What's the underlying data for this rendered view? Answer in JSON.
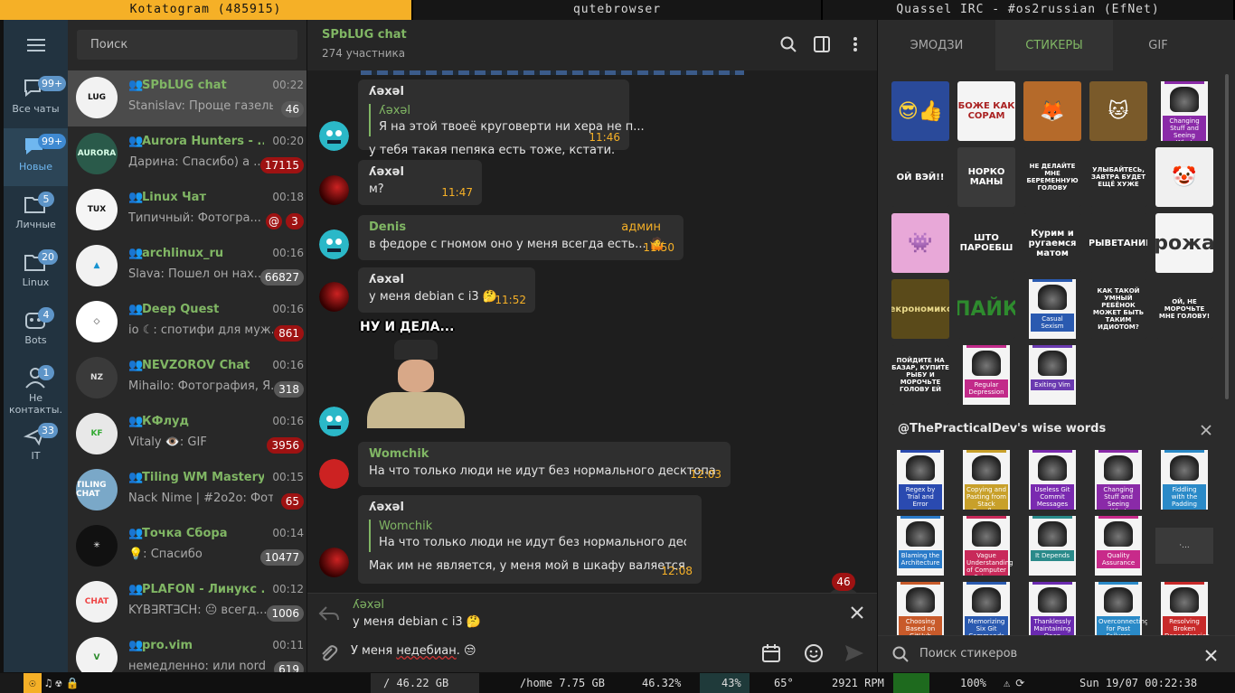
{
  "topbar": {
    "tabs": [
      {
        "label": "Kotatogram (485915)",
        "active": true
      },
      {
        "label": "qutebrowser",
        "active": false
      },
      {
        "label": "Quassel IRC - #os2russian (EfNet)",
        "active": false
      }
    ]
  },
  "folders": [
    {
      "label": "Все чаты",
      "badge": "99+",
      "icon": "chat-bubbles-icon",
      "active": false
    },
    {
      "label": "Новые",
      "badge": "99+",
      "icon": "chat-bubble-icon",
      "active": true
    },
    {
      "label": "Личные",
      "badge": "5",
      "icon": "folder-icon",
      "active": false
    },
    {
      "label": "Linux",
      "badge": "20",
      "icon": "folder-icon",
      "active": false
    },
    {
      "label": "Bots",
      "badge": "4",
      "icon": "bot-icon",
      "active": false
    },
    {
      "label": "Не контакты.",
      "badge": "1",
      "icon": "person-icon",
      "active": false
    },
    {
      "label": "IT",
      "badge": "33",
      "icon": "plane-icon",
      "active": false
    }
  ],
  "chatlist": {
    "search_placeholder": "Поиск",
    "chats": [
      {
        "name": "SPbLUG chat",
        "time": "00:22",
        "preview": "Stanislav: Проще газель ...",
        "badge": "46",
        "red": false,
        "mention": false,
        "selected": true,
        "av_bg": "#f2f2f2",
        "av_fg": "#111",
        "av_text": "LUG"
      },
      {
        "name": "Aurora Hunters - ...",
        "time": "00:20",
        "preview": "Дарина: Спасибо) а ...",
        "badge": "17115",
        "red": true,
        "mention": false,
        "selected": false,
        "av_bg": "#2a5a4a",
        "av_fg": "#d8ffe8",
        "av_text": "AURORA"
      },
      {
        "name": "Linux Чат",
        "time": "00:18",
        "preview": "Типичный: Фотогра...",
        "badge": "3",
        "red": true,
        "mention": true,
        "selected": false,
        "av_bg": "#f5f5f5",
        "av_fg": "#111",
        "av_text": "TUX"
      },
      {
        "name": "archlinux_ru",
        "time": "00:16",
        "preview": "Slava: Пошел он нах...",
        "badge": "66827",
        "red": false,
        "mention": false,
        "selected": false,
        "av_bg": "#f2f2f2",
        "av_fg": "#1793d1",
        "av_text": "▲"
      },
      {
        "name": "Deep Quest",
        "time": "00:16",
        "preview": "io ☾: спотифи для муж...",
        "badge": "861",
        "red": true,
        "mention": false,
        "selected": false,
        "av_bg": "#ffffff",
        "av_fg": "#333",
        "av_text": "◇"
      },
      {
        "name": "NEVZOROV Chat",
        "time": "00:16",
        "preview": "Mihailo: Фотография, Я...",
        "badge": "318",
        "red": false,
        "mention": false,
        "selected": false,
        "av_bg": "#3a3a3a",
        "av_fg": "#ddd",
        "av_text": "NZ"
      },
      {
        "name": "КФлуд",
        "time": "00:16",
        "preview": "Vitaly 👁️: GIF",
        "badge": "3956",
        "red": true,
        "mention": false,
        "selected": false,
        "av_bg": "#e8e8e8",
        "av_fg": "#3a3",
        "av_text": "KF"
      },
      {
        "name": "Tiling WM Mastery",
        "time": "00:15",
        "preview": "Nack Nime | #2o2o: Фот...",
        "badge": "65",
        "red": true,
        "mention": false,
        "selected": false,
        "av_bg": "#7aa8c8",
        "av_fg": "#fff",
        "av_text": "TILING CHAT"
      },
      {
        "name": "Точка Сбора",
        "time": "00:14",
        "preview": "💡: Спасибо",
        "badge": "10477",
        "red": false,
        "mention": false,
        "selected": false,
        "av_bg": "#111",
        "av_fg": "#fff",
        "av_text": "✳"
      },
      {
        "name": "PLAFON - Линукс ...",
        "time": "00:12",
        "preview": "KYB∃RT∃CH: 😐 всегд...",
        "badge": "1006",
        "red": false,
        "mention": false,
        "selected": false,
        "av_bg": "#f2f2f2",
        "av_fg": "#e44",
        "av_text": "CHAT"
      },
      {
        "name": "pro.vim",
        "time": "00:11",
        "preview": "немедленно: или nord",
        "badge": "619",
        "red": false,
        "mention": false,
        "selected": false,
        "av_bg": "#f2f2f2",
        "av_fg": "#2a8a2a",
        "av_text": "V"
      }
    ]
  },
  "chat": {
    "title": "SPbLUG chat",
    "subtitle": "274 участника",
    "messages": [
      {
        "sender": "ʎəxəl",
        "reply_name": "ʎəxəl",
        "reply_text": "Я на этой твоеё круговерти ни хера не п...",
        "text": "у тебя такая пепяка есть тоже, кстати.",
        "time": "11:46",
        "admin": ""
      },
      {
        "sender": "ʎəxəl",
        "text": "м?",
        "time": "11:47",
        "admin": ""
      },
      {
        "sender": "Denis",
        "text": "в федоре с гномом оно у меня всегда есть... 🤷",
        "time": "11:50",
        "admin": "админ"
      },
      {
        "sender": "ʎəxəl",
        "text": "у меня debian с i3 🤔",
        "time": "11:52",
        "admin": ""
      },
      {
        "sticker_caption": "НУ И ДЕЛА..."
      },
      {
        "sender": "Womchik",
        "text": "На что только люди не идут без нормального десктопа",
        "time": "12:03",
        "admin": ""
      },
      {
        "sender": "ʎəxəl",
        "reply_name": "Womchik",
        "reply_text": "На что только люди не идут без нормального десктo...",
        "text": "Мак им не является, у меня мой в шкафу валяется.",
        "time": "12:08",
        "admin": ""
      }
    ],
    "unread_badge": "46",
    "reply_bar": {
      "name": "ʎəxəl",
      "text": "у меня debian с i3 🤔"
    },
    "compose": {
      "prefix": "У меня ",
      "misspelled": "недебиан",
      "suffix": ". 😒"
    }
  },
  "panel": {
    "tabs": [
      {
        "label": "ЭМОДЗИ",
        "active": false
      },
      {
        "label": "СТИКЕРЫ",
        "active": true
      },
      {
        "label": "GIF",
        "active": false
      }
    ],
    "stickers_top": [
      {
        "bg": "#2a4a9a",
        "fg": "#ffd23a",
        "text": "😎👍"
      },
      {
        "bg": "#f4f4f4",
        "fg": "#a22",
        "text": "БОЖЕ КАК СОРАМ"
      },
      {
        "bg": "#b56a2a",
        "fg": "#fff",
        "text": "🦊"
      },
      {
        "bg": "#7a5a2a",
        "fg": "#fff",
        "text": "🐱"
      },
      {
        "ora": true,
        "bar": "#8a2aa8",
        "title": "Changing Stuff and Seeing What Happens",
        "tcolor": "#8a2aa8"
      },
      {
        "bg": "#2b2b2b",
        "fg": "#fff",
        "text": "ОЙ ВЭЙ!!"
      },
      {
        "bg": "#3a3a3a",
        "fg": "#fff",
        "text": "НОРКО МАНЫ"
      },
      {
        "bg": "#2b2b2b",
        "fg": "#fff",
        "text": "НЕ ДЕЛАЙТЕ МНЕ БЕРЕМЕННУЮ ГОЛОВУ"
      },
      {
        "bg": "#2b2b2b",
        "fg": "#fff",
        "text": "УЛЫБАЙТЕСЬ, ЗАВТРА БУДЕТ ЕЩЁ ХУЖЕ"
      },
      {
        "bg": "#f0f0f0",
        "fg": "#d22",
        "text": "🤡"
      },
      {
        "bg": "#e8a8d8",
        "fg": "#fff",
        "text": "👾"
      },
      {
        "bg": "#2b2b2b",
        "fg": "#fff",
        "text": "ШТО ПАРОЕБШ"
      },
      {
        "bg": "#2b2b2b",
        "fg": "#fff",
        "text": "Курим и ругаемся матом"
      },
      {
        "bg": "#2b2b2b",
        "fg": "#fff",
        "text": "ПРЫВЕТАНИЕ!"
      },
      {
        "bg": "#f4f4f4",
        "fg": "#333",
        "text": "рожа"
      },
      {
        "bg": "#5a4a1a",
        "fg": "#e8d88a",
        "text": "Некрономикон"
      },
      {
        "bg": "#2b2b2b",
        "fg": "#2e8b2e",
        "text": "ПАЙК"
      },
      {
        "ora": true,
        "bar": "#2a5ab0",
        "title": "Casual Sexism",
        "tcolor": "#2a5ab0"
      },
      {
        "bg": "#2b2b2b",
        "fg": "#fff",
        "text": "КАК ТАКОЙ УМНЫЙ РЕБЁНОК МОЖЕТ БЫТЬ ТАКИМ ИДИОТОМ?"
      },
      {
        "bg": "#2b2b2b",
        "fg": "#fff",
        "text": "ОЙ, НЕ МОРОЧЬТЕ МНЕ ГОЛОВУ!"
      },
      {
        "bg": "#2b2b2b",
        "fg": "#fff",
        "text": "ПОЙДИТЕ НА БАЗАР, КУПИТЕ РЫБУ И МОРОЧЬТЕ ГОЛОВУ ЕЙ"
      },
      {
        "ora": true,
        "bar": "#c22a8a",
        "title": "Regular Depression",
        "tcolor": "#c22a8a"
      },
      {
        "ora": true,
        "bar": "#6a3ab0",
        "title": "Exiting Vim",
        "tcolor": "#6a3ab0"
      }
    ],
    "pack_title": "@ThePracticalDev's wise words",
    "stickers_pack": [
      {
        "ora": true,
        "bar": "#2a4ab0",
        "title": "Regex by Trial and Error",
        "tcolor": "#2a4ab0"
      },
      {
        "ora": true,
        "bar": "#c8a02a",
        "title": "Copying and Pasting from Stack Overflow",
        "tcolor": "#c8a02a"
      },
      {
        "ora": true,
        "bar": "#7a2ab0",
        "title": "Useless Git Commit Messages",
        "tcolor": "#7a2ab0"
      },
      {
        "ora": true,
        "bar": "#8a2aa8",
        "title": "Changing Stuff and Seeing What Happens",
        "tcolor": "#8a2aa8"
      },
      {
        "ora": true,
        "bar": "#2a8ac8",
        "title": "Fiddling with the Padding",
        "tcolor": "#2a8ac8"
      },
      {
        "ora": true,
        "bar": "#2a7ac8",
        "title": "Blaming the Architecture",
        "tcolor": "#2a7ac8"
      },
      {
        "ora": true,
        "bar": "#c82a5a",
        "title": "Vague Understanding of Computer Science",
        "tcolor": "#c82a5a"
      },
      {
        "ora": true,
        "bar": "#2a8a8a",
        "title": "It Depends",
        "tcolor": "#2a8a8a"
      },
      {
        "ora": true,
        "bar": "#c82a8a",
        "title": "Quality Assurance",
        "tcolor": "#c82a8a"
      },
      {
        "dark": true,
        "text": "·..."
      },
      {
        "ora": true,
        "bar": "#c85a2a",
        "title": "Choosing Based on GitHub Stars",
        "tcolor": "#c85a2a"
      },
      {
        "ora": true,
        "bar": "#2a5ab0",
        "title": "Memorizing Six Git Commands",
        "tcolor": "#2a5ab0"
      },
      {
        "ora": true,
        "bar": "#6a2ab0",
        "title": "Thanklessly Maintaining Open Source Software",
        "tcolor": "#6a2ab0"
      },
      {
        "ora": true,
        "bar": "#2a8ac8",
        "title": "Overconnecting for Past Failures",
        "tcolor": "#2a8ac8"
      },
      {
        "ora": true,
        "bar": "#c82a2a",
        "title": "Resolving Broken Dependencies",
        "tcolor": "#c82a2a"
      }
    ],
    "search_placeholder": "Поиск стикеров"
  },
  "bottombar": {
    "disk_root": "/ 46.22 GB",
    "disk_home": "/home 7.75 GB",
    "cpu": "46.32%",
    "mem": "43%",
    "temp": "65°",
    "fan": "2921 RPM",
    "volume": "100%",
    "datetime": "Sun 19/07 00:22:38"
  }
}
